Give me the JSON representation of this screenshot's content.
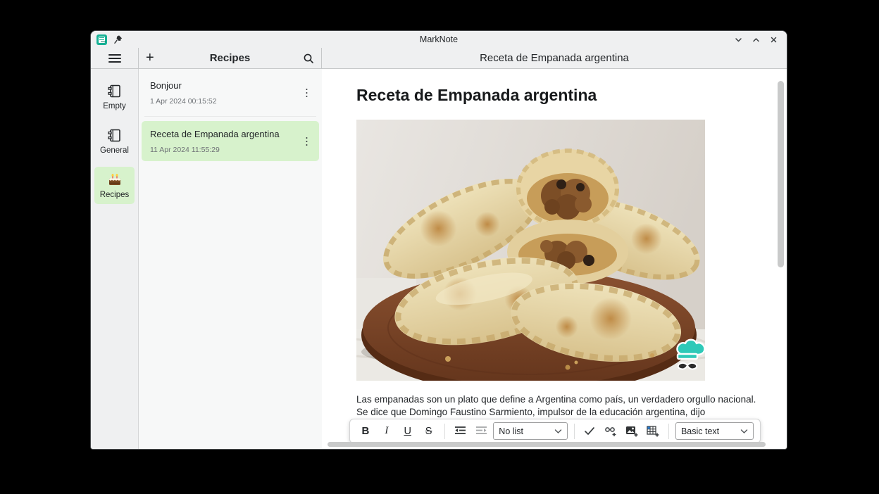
{
  "app": {
    "title": "MarkNote"
  },
  "window_controls": {
    "minimize": "minimize",
    "maximize": "maximize",
    "close": "close"
  },
  "panel_headers": {
    "notebook_title": "Recipes",
    "note_title": "Receta de Empanada argentina"
  },
  "sidebar": {
    "items": [
      {
        "label": "Empty",
        "icon": "notebook-icon",
        "selected": false
      },
      {
        "label": "General",
        "icon": "notebook-icon",
        "selected": false
      },
      {
        "label": "Recipes",
        "icon": "birthday-cake-icon",
        "selected": true
      }
    ]
  },
  "notes": [
    {
      "title": "Bonjour",
      "date": "1 Apr 2024 00:15:52",
      "selected": false
    },
    {
      "title": "Receta de Empanada argentina",
      "date": "11 Apr 2024 11:55:29",
      "selected": true
    }
  ],
  "editor": {
    "heading": "Receta de Empanada argentina",
    "paragraph": "Las empanadas son un plato que define a Argentina como país, un verdadero orgullo nacional. Se dice que Domingo Faustino Sarmiento, impulsor de la educación argentina, dijo",
    "image_description": "empanadas-photo-with-chef-watermark"
  },
  "format_toolbar": {
    "bold": "B",
    "italic": "I",
    "underline": "U",
    "strikethrough": "S",
    "list_style_value": "No list",
    "text_style_value": "Basic text"
  },
  "icons": {
    "menu": "≡",
    "add_note": "+",
    "more": "⋮"
  },
  "colors": {
    "selection_green": "#d7f2cc",
    "chrome_bg": "#eff0f1",
    "accent_teal": "#2ec9b8",
    "table_icon_blue": "#2a7fd4"
  }
}
